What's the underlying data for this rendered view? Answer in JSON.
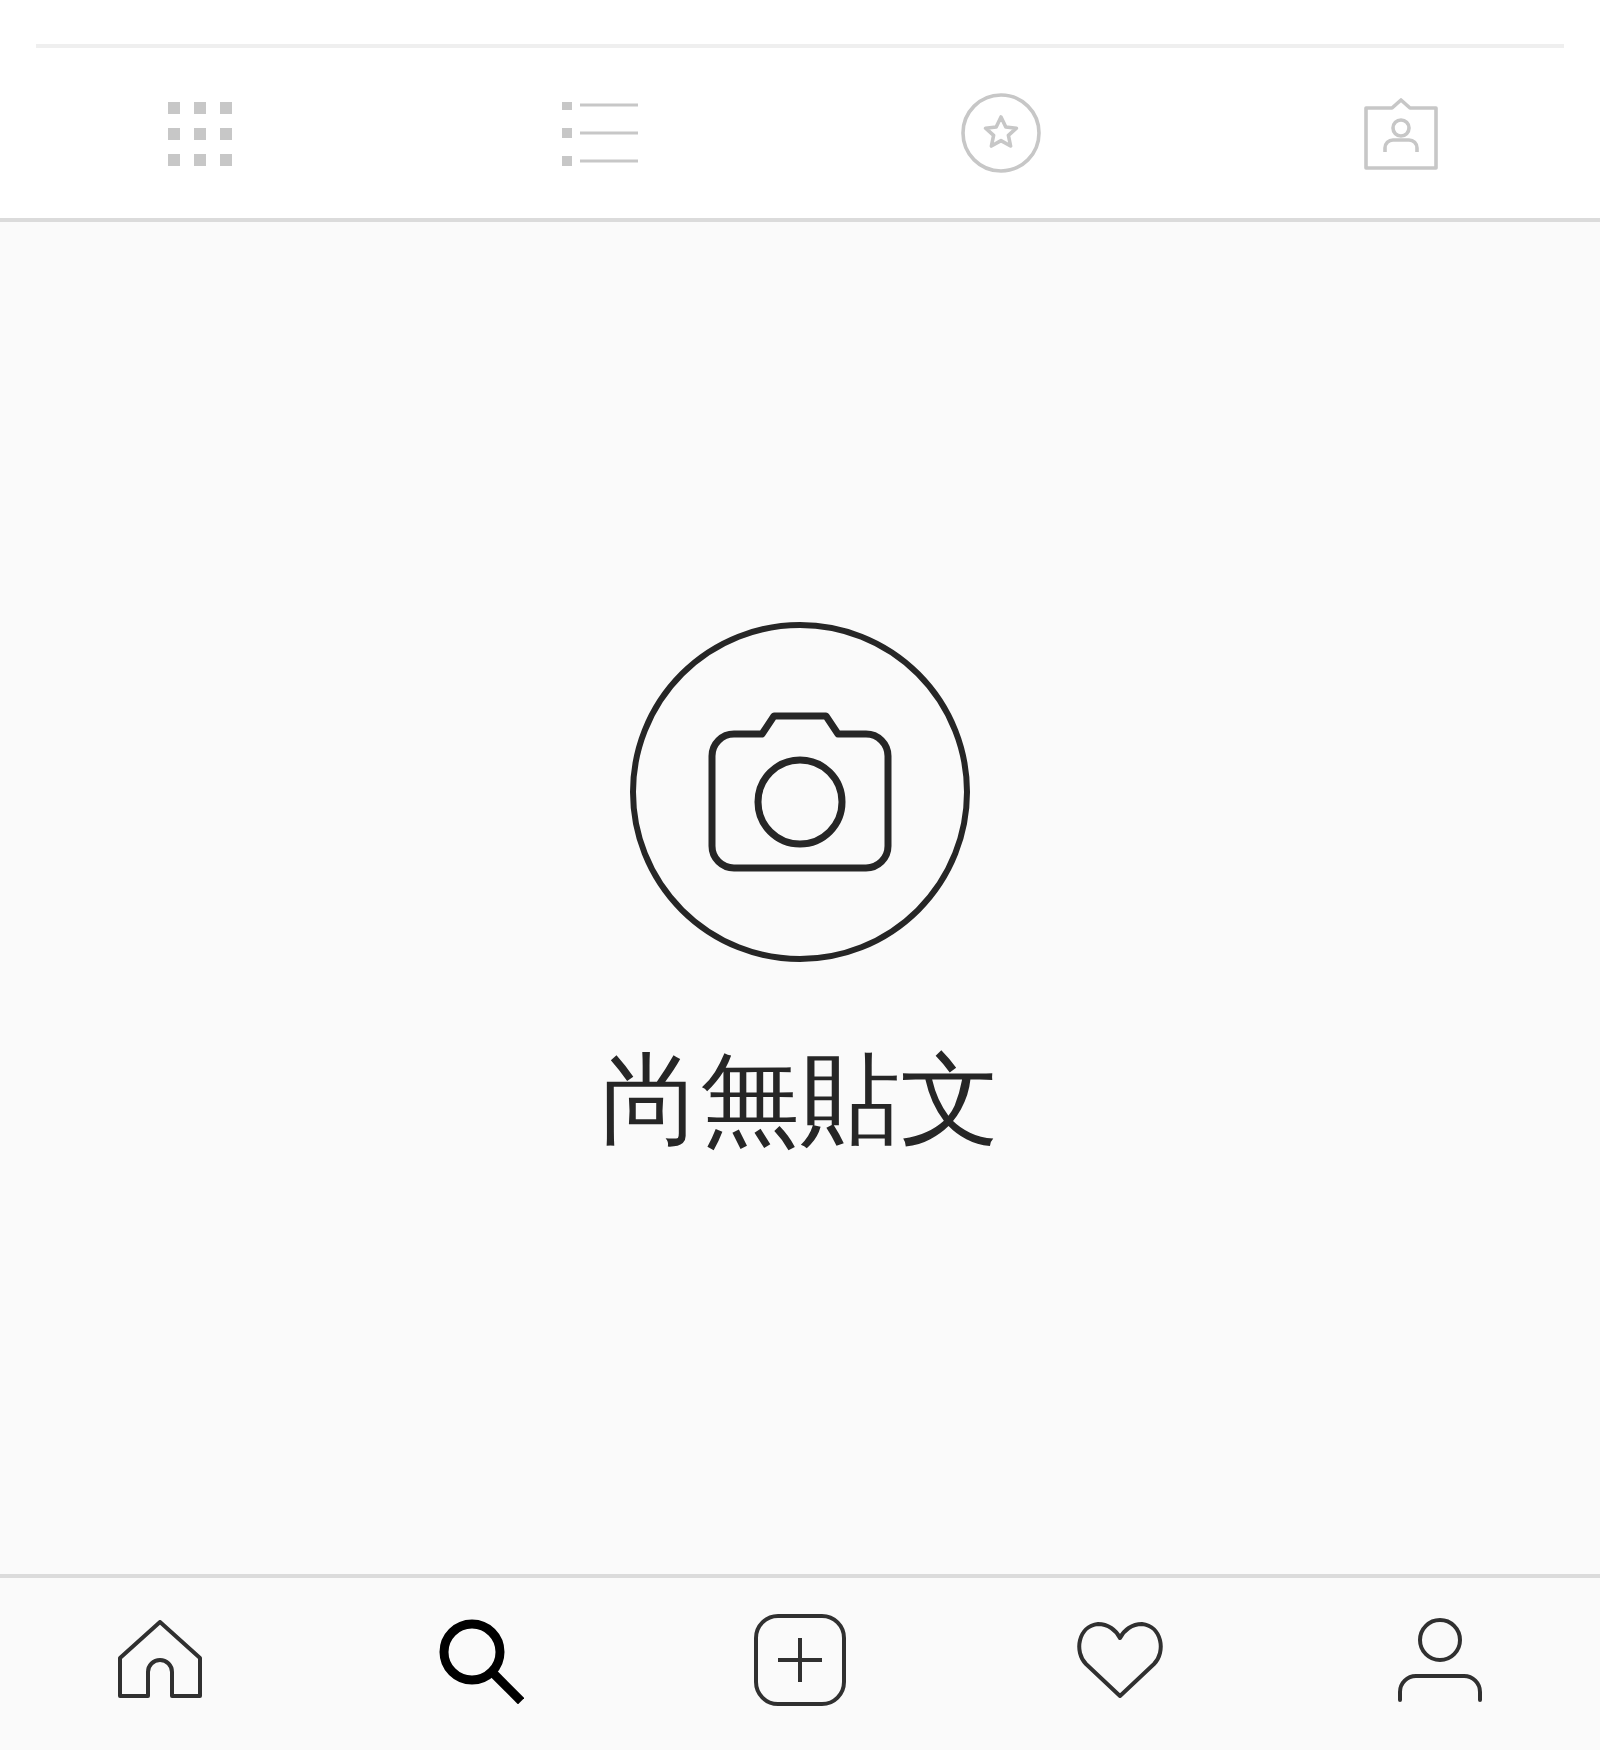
{
  "profile_tabs": [
    {
      "kind": "grid",
      "selected": false
    },
    {
      "kind": "list",
      "selected": false
    },
    {
      "kind": "saved",
      "selected": false
    },
    {
      "kind": "tagged",
      "selected": false
    }
  ],
  "empty_state": {
    "text": "尚無貼文"
  },
  "bottom_nav": [
    {
      "kind": "home",
      "selected": false
    },
    {
      "kind": "search",
      "selected": true
    },
    {
      "kind": "add",
      "selected": false
    },
    {
      "kind": "activity",
      "selected": false
    },
    {
      "kind": "profile",
      "selected": false
    }
  ]
}
